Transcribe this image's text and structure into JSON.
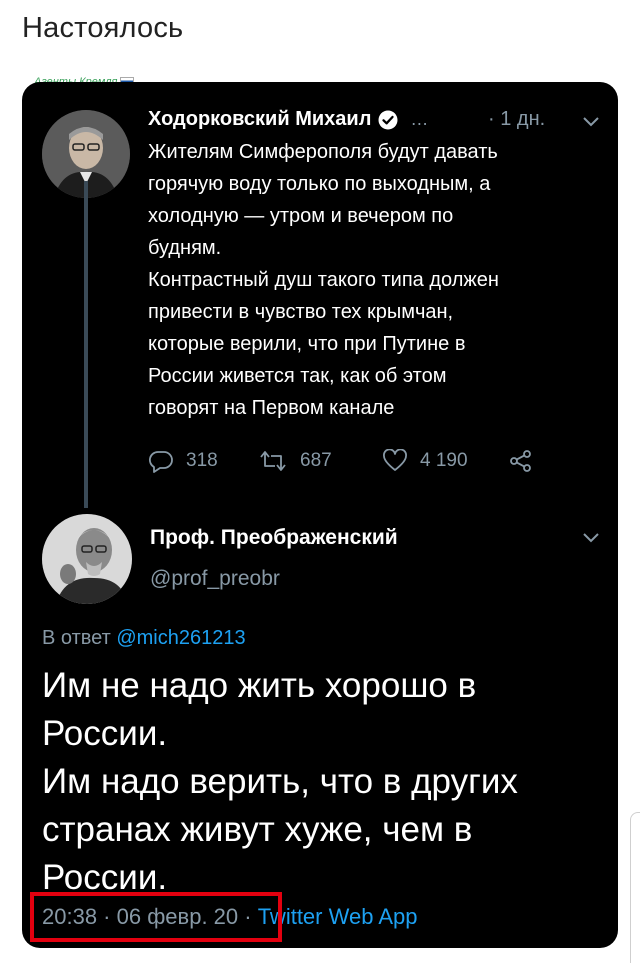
{
  "post_title": "Настоялось",
  "watermark": "Агенты Кремля",
  "tweet1": {
    "author": "Ходорковский Михаил",
    "verified": true,
    "dots": "…",
    "time": "· 1 дн.",
    "text_lines": [
      "Жителям Симферополя будут давать",
      "горячую воду только по выходным, а",
      "холодную — утром и вечером по",
      "будням.",
      "Контрастный душ такого типа должен",
      "привести в чувство тех крымчан,",
      "которые верили, что при Путине в",
      "России живется так, как об этом",
      "говорят на Первом канале"
    ],
    "replies": "318",
    "retweets": "687",
    "likes": "4 190"
  },
  "tweet2": {
    "author": "Проф. Преображенский",
    "handle": "@prof_preobr",
    "reply_prefix": "В ответ",
    "reply_to": "@mich261213",
    "text_lines": [
      "Им не надо жить хорошо в",
      "России.",
      "Им надо верить, что в других",
      "странах живут хуже, чем в",
      "России."
    ],
    "timestamp": "20:38 · 06 февр. 20 · ",
    "source": "Twitter Web App"
  },
  "colors": {
    "background": "#000000",
    "text": "#ffffff",
    "muted": "#8899a6",
    "link": "#1da1f2",
    "highlight": "#e3000f",
    "watermark": "#3aa15a"
  },
  "icons": [
    "verified-badge-icon",
    "chevron-down-icon",
    "reply-icon",
    "retweet-icon",
    "like-icon",
    "share-icon"
  ]
}
